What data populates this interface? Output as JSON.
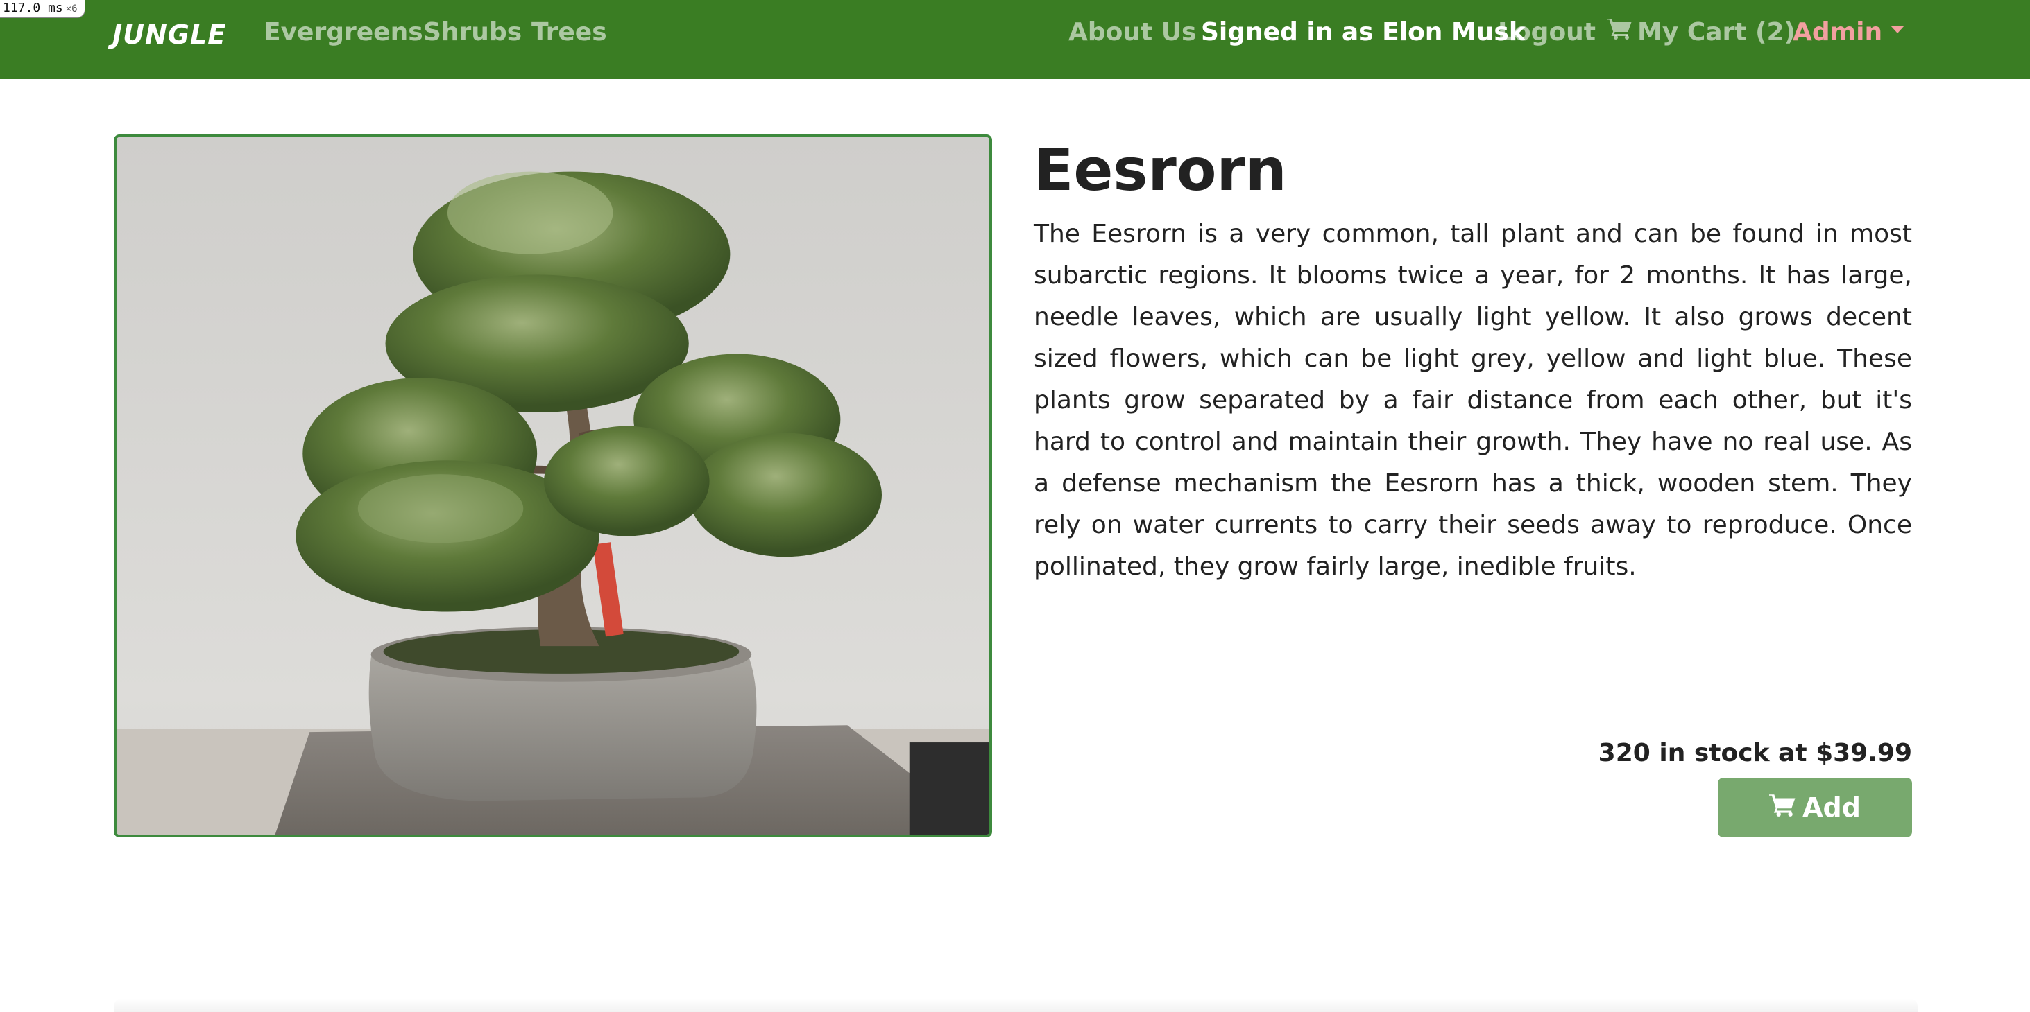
{
  "perf": {
    "time": "117.0",
    "unit": "ms",
    "multiplier": "×6"
  },
  "navbar": {
    "brand": "JUNGLE",
    "links": [
      {
        "label": "Evergreens"
      },
      {
        "label": "Shrubs"
      },
      {
        "label": "Trees"
      }
    ],
    "about": "About Us",
    "signed_in": "Signed in as Elon Musk",
    "logout": "Logout",
    "cart": "My Cart (2)",
    "admin": "Admin",
    "colors": {
      "background": "#3a7d23",
      "admin": "#f2a0a0"
    }
  },
  "product": {
    "name": "Eesrorn",
    "description": "The Eesrorn is a very common, tall plant and can be found in most subarctic regions. It blooms twice a year, for 2 months. It has large, needle leaves, which are usually light yellow. It also grows decent sized flowers, which can be light grey, yellow and light blue. These plants grow separated by a fair distance from each other, but it's hard to control and maintain their growth. They have no real use. As a defense mechanism the Eesrorn has a thick, wooden stem. They rely on water currents to carry their seeds away to reproduce. Once pollinated, they grow fairly large, inedible fruits.",
    "stock_text": "320 in stock at $39.99",
    "add_label": "Add",
    "image_icon": "bonsai-photo",
    "button_color": "#78a96e"
  }
}
